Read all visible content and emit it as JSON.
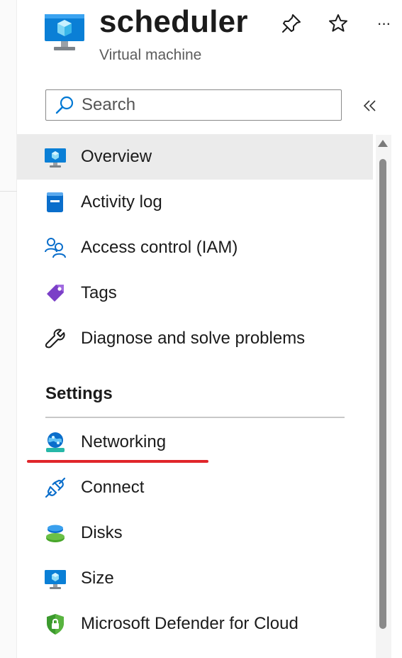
{
  "header": {
    "title": "scheduler",
    "subtitle": "Virtual machine",
    "icons": {
      "resource": "virtual-machine-icon",
      "pin": "pin-icon",
      "favorite": "star-icon",
      "more": "more-icon"
    },
    "more_label": "···"
  },
  "search": {
    "placeholder": "Search",
    "value": "",
    "collapse_icon": "double-chevron-left-icon"
  },
  "nav_items": [
    {
      "label": "Overview",
      "icon": "virtual-machine-icon",
      "selected": true
    },
    {
      "label": "Activity log",
      "icon": "activity-log-icon"
    },
    {
      "label": "Access control (IAM)",
      "icon": "people-icon"
    },
    {
      "label": "Tags",
      "icon": "tag-icon"
    },
    {
      "label": "Diagnose and solve problems",
      "icon": "wrench-icon"
    }
  ],
  "settings": {
    "title": "Settings",
    "items": [
      {
        "label": "Networking",
        "icon": "networking-globe-icon",
        "annotated": true
      },
      {
        "label": "Connect",
        "icon": "plug-icon"
      },
      {
        "label": "Disks",
        "icon": "disks-icon"
      },
      {
        "label": "Size",
        "icon": "monitor-size-icon"
      },
      {
        "label": "Microsoft Defender for Cloud",
        "icon": "shield-lock-icon"
      }
    ]
  },
  "colors": {
    "accent_blue": "#0078d4",
    "selected_bg": "#ebebeb",
    "annotation_red": "#e0262b",
    "scroll_thumb": "#8a8a8a"
  }
}
